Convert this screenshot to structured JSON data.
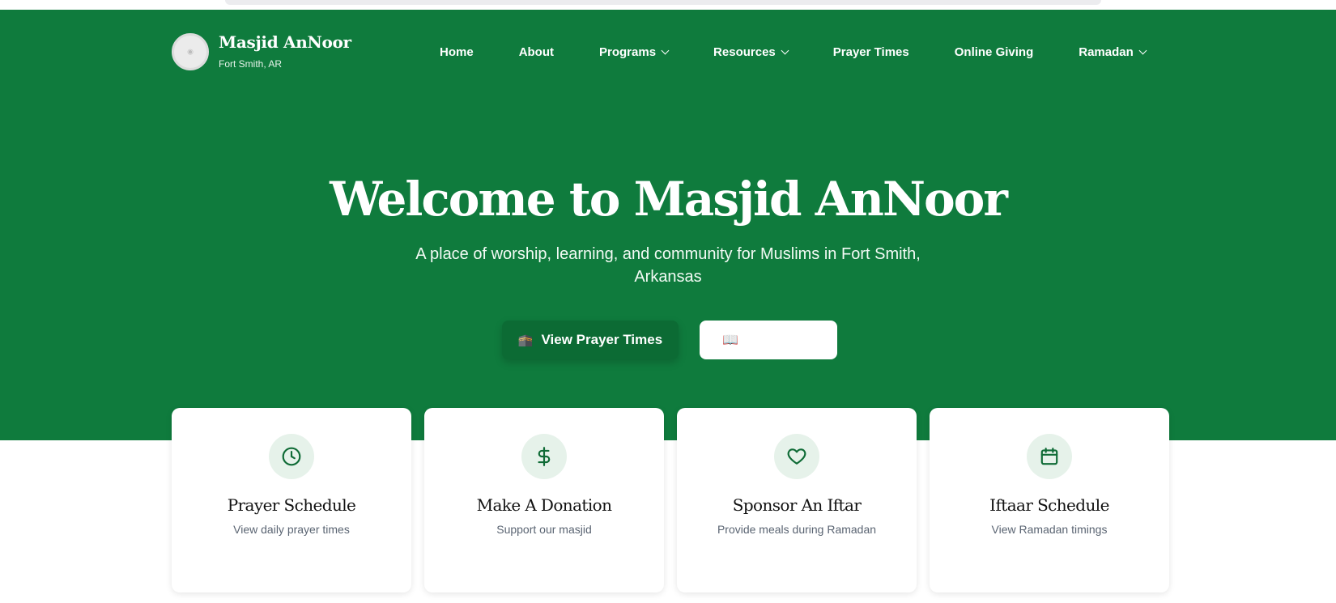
{
  "brand": {
    "name": "Masjid AnNoor",
    "location": "Fort Smith, AR"
  },
  "nav": {
    "items": [
      {
        "label": "Home"
      },
      {
        "label": "About"
      },
      {
        "label": "Programs"
      },
      {
        "label": "Resources"
      },
      {
        "label": "Prayer Times"
      },
      {
        "label": "Online Giving"
      },
      {
        "label": "Ramadan"
      }
    ]
  },
  "hero": {
    "title": "Welcome to Masjid AnNoor",
    "subtitle": "A place of worship, learning, and community for Muslims in Fort Smith, Arkansas",
    "primary_button": {
      "icon": "🕋",
      "label": "View Prayer Times"
    },
    "secondary_button": {
      "icon": "📖"
    }
  },
  "cards": [
    {
      "icon": "clock-icon",
      "title": "Prayer Schedule",
      "desc": "View daily prayer times"
    },
    {
      "icon": "dollar-icon",
      "title": "Make A Donation",
      "desc": "Support our masjid"
    },
    {
      "icon": "heart-icon",
      "title": "Sponsor An Iftar",
      "desc": "Provide meals during Ramadan"
    },
    {
      "icon": "calendar-icon",
      "title": "Iftaar Schedule",
      "desc": "View Ramadan timings"
    }
  ],
  "colors": {
    "primary": "#0f7b3d",
    "primary_dark": "#0c6b34",
    "icon_bg": "#e6f2ea",
    "icon_stroke": "#0f6b36"
  }
}
